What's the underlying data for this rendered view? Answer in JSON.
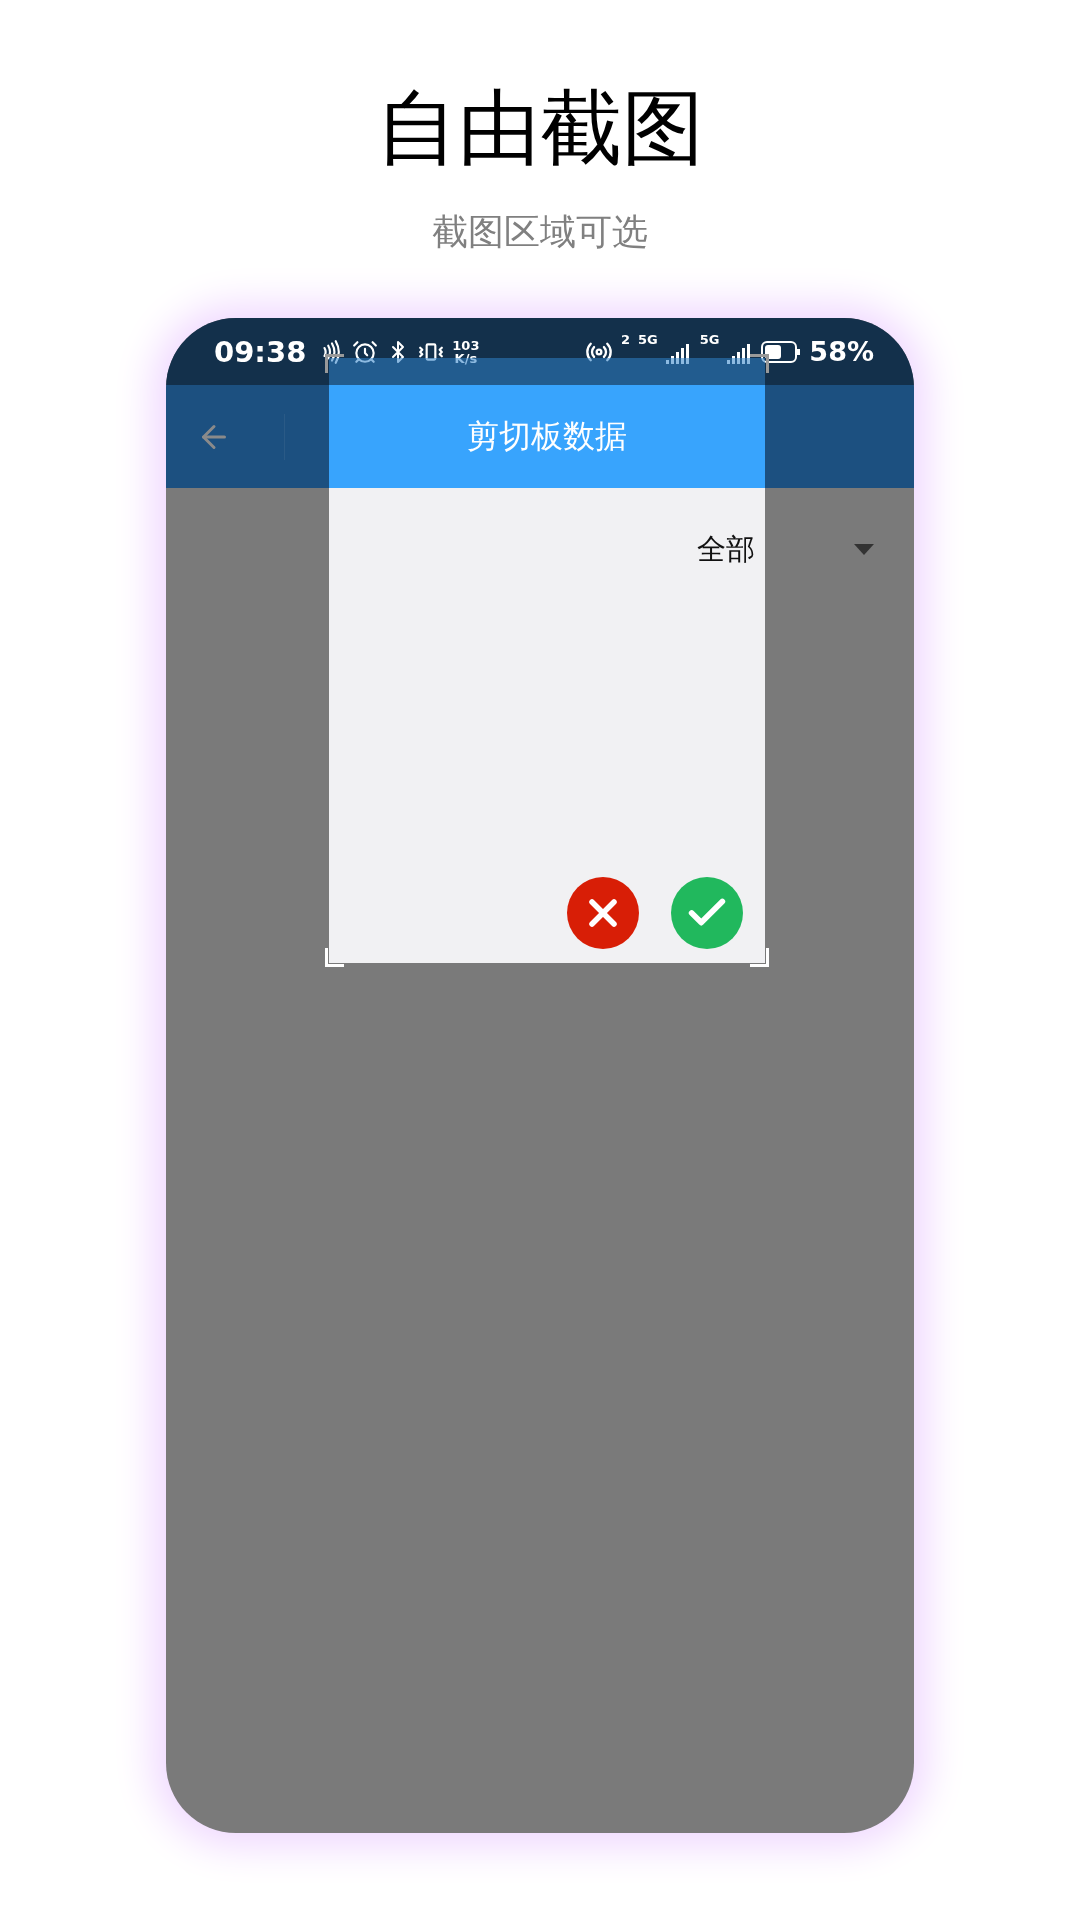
{
  "title": "自由截图",
  "subtitle": "截图区域可选",
  "status_bar": {
    "time": "09:38",
    "net_speed": "103",
    "net_speed_unit": "K/s",
    "sim_badge": "2",
    "network_1": "5G",
    "network_2": "5G",
    "battery": "58%"
  },
  "dialog": {
    "title": "剪切板数据",
    "filter": "全部",
    "buttons": [
      {
        "kind": "cancel"
      },
      {
        "kind": "confirm"
      }
    ]
  }
}
